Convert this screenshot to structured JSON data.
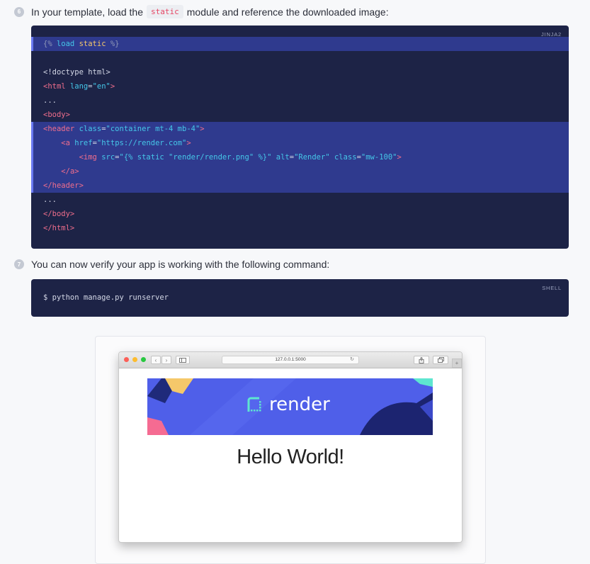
{
  "step6": {
    "number": "6",
    "text_before": "In your template, load the",
    "code": "static",
    "text_after": "module and reference the downloaded image:"
  },
  "codeblock1": {
    "language": "JINJA2",
    "lines": [
      "{% load static %}",
      "",
      "<!doctype html>",
      "<html lang=\"en\">",
      "...",
      "<body>",
      "<header class=\"container mt-4 mb-4\">",
      "    <a href=\"https://render.com\">",
      "        <img src=\"{% static \"render/render.png\" %}\" alt=\"Render\" class=\"mw-100\">",
      "    </a>",
      "</header>",
      "...",
      "</body>",
      "</html>"
    ]
  },
  "step7": {
    "number": "7",
    "text": "You can now verify your app is working with the following command:"
  },
  "codeblock2": {
    "language": "SHELL",
    "command": "$ python manage.py runserver"
  },
  "browser": {
    "url": "127.0.0.1:5000",
    "logo_text": "render",
    "heading": "Hello World!",
    "colors": {
      "close": "#fc5f57",
      "minimize": "#fdbc2e",
      "zoom": "#28c840",
      "banner": "#4f5fe9",
      "accent_teal": "#5ee6d0"
    }
  }
}
